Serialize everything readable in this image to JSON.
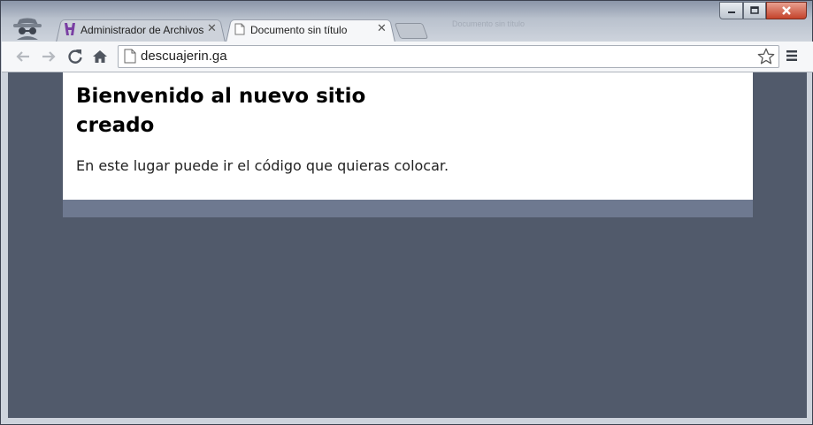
{
  "browser": {
    "tabs": [
      {
        "label": "Administrador de Archivos",
        "favicon": "purple-h-logo-icon",
        "active": false
      },
      {
        "label": "Documento sin título",
        "favicon": "blank-page-icon",
        "active": true
      }
    ],
    "faded_window_title": "Documento sin título",
    "url": "descuajerin.ga",
    "colors": {
      "accent_close": "#c4432b",
      "favicon": "#7a3fa3"
    }
  },
  "page": {
    "heading": "Bienvenido al nuevo sitio creado",
    "paragraph": "En este lugar puede ir el código que quieras colocar.",
    "colors": {
      "background": "#515a6b",
      "panel": "#ffffff",
      "strip": "#6e7990"
    }
  },
  "icons": {
    "incognito": "incognito-icon",
    "back": "back-arrow-icon",
    "forward": "forward-arrow-icon",
    "reload": "reload-icon",
    "home": "home-icon",
    "bookmark": "star-icon",
    "menu": "hamburger-menu-icon"
  }
}
